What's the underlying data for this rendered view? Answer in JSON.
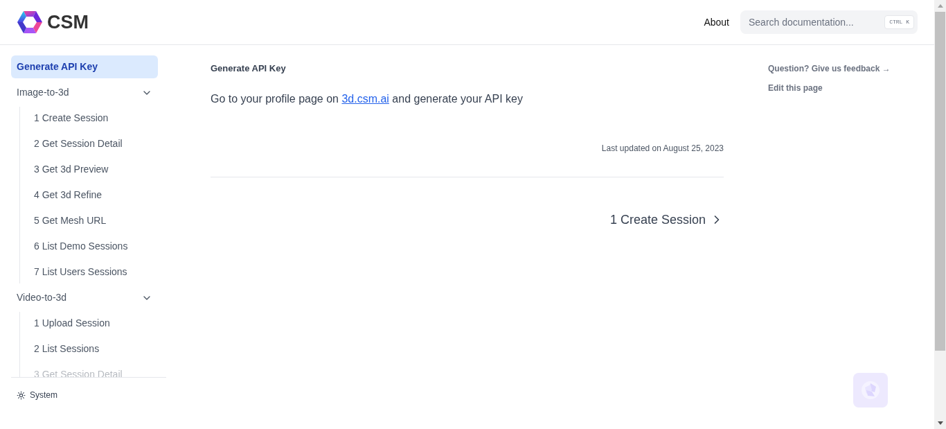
{
  "header": {
    "logo_text": "CSM",
    "nav_link": "About",
    "search": {
      "placeholder": "Search documentation...",
      "shortcut": "CTRL K"
    }
  },
  "sidebar": {
    "items": [
      {
        "label": "Generate API Key",
        "selected": true
      },
      {
        "label": "Image-to-3d",
        "selected": false,
        "expanded": true,
        "children": [
          {
            "label": "1 Create Session",
            "selected": false
          },
          {
            "label": "2 Get Session Detail",
            "selected": false
          },
          {
            "label": "3 Get 3d Preview",
            "selected": false
          },
          {
            "label": "4 Get 3d Refine",
            "selected": false
          },
          {
            "label": "5 Get Mesh URL",
            "selected": false
          },
          {
            "label": "6 List Demo Sessions",
            "selected": false
          },
          {
            "label": "7 List Users Sessions",
            "selected": false
          }
        ]
      },
      {
        "label": "Video-to-3d",
        "selected": false,
        "expanded": true,
        "children": [
          {
            "label": "1 Upload Session",
            "selected": false
          },
          {
            "label": "2 List Sessions",
            "selected": false
          },
          {
            "label": "3 Get Session Detail",
            "selected": false
          }
        ]
      }
    ],
    "theme_toggle": "System"
  },
  "content": {
    "breadcrumb": "Generate API Key",
    "paragraph": {
      "before": "Go to your profile page on ",
      "link": "3d.csm.ai",
      "after": " and generate your API key"
    },
    "last_updated": "Last updated on August 25, 2023",
    "next_link": "1 Create Session"
  },
  "toc": {
    "links": [
      "Question? Give us feedback →",
      "Edit this page"
    ]
  }
}
